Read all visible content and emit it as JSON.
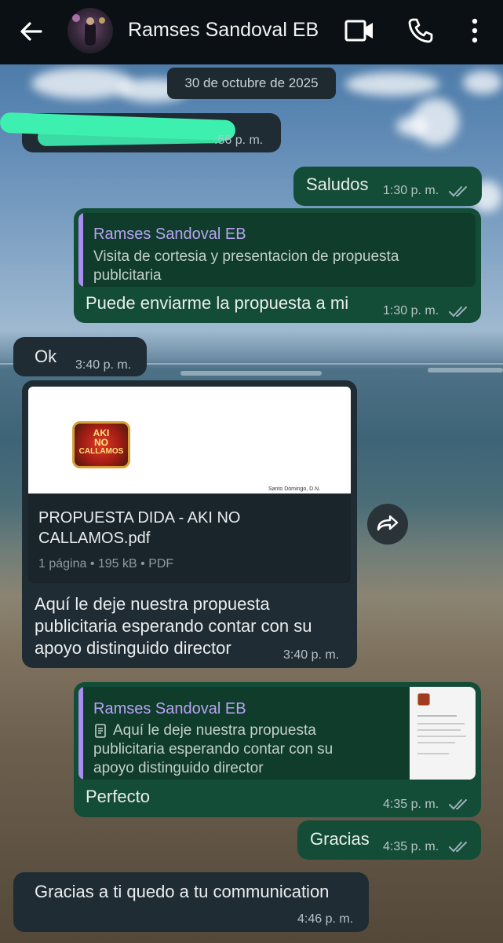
{
  "header": {
    "contact_name": "Ramses Sandoval EB",
    "back_icon": "arrow-left-icon",
    "video_icon": "video-camera-icon",
    "call_icon": "phone-icon",
    "menu_icon": "more-vertical-icon"
  },
  "date_chip": "30 de octubre de 2025",
  "messages": {
    "m1": {
      "time_visible": ":56 p. m."
    },
    "m2": {
      "text": "Saludos",
      "time": "1:30 p. m."
    },
    "m3": {
      "quote_name": "Ramses Sandoval EB",
      "quote_text": "Visita de cortesia y presentacion de propuesta publcitaria",
      "text": "Puede enviarme la propuesta a mi",
      "time": "1:30 p. m."
    },
    "m4": {
      "text": "Ok",
      "time": "3:40 p. m."
    },
    "m5": {
      "preview_logo_lines": [
        "AKI",
        "NO",
        "CALLAMOS"
      ],
      "preview_footer": "Santo Domingo, D.N.",
      "file_name_line1": "PROPUESTA DIDA - AKI NO",
      "file_name_line2": "CALLAMOS.pdf",
      "file_meta": "1 página • 195 kB • PDF",
      "caption_line1": "Aquí le deje nuestra propuesta",
      "caption_line2": "publicitaria esperando contar con su",
      "caption_line3": "apoyo distinguido director",
      "time": "3:40 p. m."
    },
    "m6": {
      "quote_name": "Ramses Sandoval EB",
      "quote_line1": "Aquí le deje nuestra propuesta",
      "quote_line2": "publicitaria esperando contar con su",
      "quote_line3": "apoyo distinguido director",
      "text": "Perfecto",
      "time": "4:35 p. m."
    },
    "m7": {
      "text": "Gracias",
      "time": "4:35 p. m."
    },
    "m8": {
      "text": "Gracias a ti quedo a tu communication",
      "time": "4:46 p. m."
    }
  },
  "colors": {
    "header_bg": "#0b1014",
    "incoming_bubble": "#1f2c33",
    "outgoing_bubble": "#144d37",
    "read_ticks": "#9ab0bb",
    "quote_accent": "#a88ef0"
  }
}
